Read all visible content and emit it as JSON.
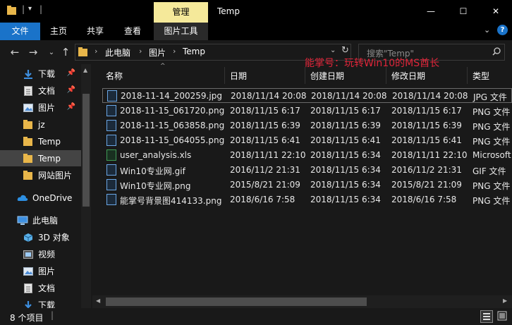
{
  "window": {
    "title": "Temp",
    "context_tab": "管理",
    "controls": {
      "minimize": "—",
      "maximize": "☐",
      "close": "✕"
    }
  },
  "ribbon": {
    "tabs": [
      "文件",
      "主页",
      "共享",
      "查看",
      "图片工具"
    ]
  },
  "address": {
    "crumbs": [
      "此电脑",
      "图片",
      "Temp"
    ],
    "search_placeholder": "搜索\"Temp\""
  },
  "watermark": "能掌号：玩转Win10的MS酋长",
  "nav": {
    "quick_access": [
      {
        "label": "下载",
        "pinned": true,
        "icon": "download-icon"
      },
      {
        "label": "文档",
        "pinned": true,
        "icon": "document-icon"
      },
      {
        "label": "图片",
        "pinned": true,
        "icon": "pictures-icon"
      },
      {
        "label": "jz",
        "pinned": false,
        "icon": "folder-icon"
      },
      {
        "label": "Temp",
        "pinned": false,
        "icon": "folder-icon"
      },
      {
        "label": "Temp",
        "pinned": false,
        "icon": "folder-icon",
        "selected": true
      },
      {
        "label": "网站图片",
        "pinned": false,
        "icon": "folder-icon"
      }
    ],
    "onedrive": "OneDrive",
    "this_pc": "此电脑",
    "pc_items": [
      {
        "label": "3D 对象",
        "icon": "3d-objects-icon"
      },
      {
        "label": "视频",
        "icon": "video-icon"
      },
      {
        "label": "图片",
        "icon": "pictures-icon"
      },
      {
        "label": "文档",
        "icon": "document-icon"
      },
      {
        "label": "下载",
        "icon": "download-icon"
      }
    ]
  },
  "columns": [
    "名称",
    "日期",
    "创建日期",
    "修改日期",
    "类型"
  ],
  "files": [
    {
      "name": "2018-11-14_200259.jpg",
      "date": "2018/11/14 20:08",
      "created": "2018/11/14 20:08",
      "modified": "2018/11/14 20:08",
      "type": "JPG 文件",
      "icon": "image-file-icon",
      "selected": true
    },
    {
      "name": "2018-11-15_061720.png",
      "date": "2018/11/15 6:17",
      "created": "2018/11/15 6:17",
      "modified": "2018/11/15 6:17",
      "type": "PNG 文件",
      "icon": "image-file-icon"
    },
    {
      "name": "2018-11-15_063858.png",
      "date": "2018/11/15 6:39",
      "created": "2018/11/15 6:39",
      "modified": "2018/11/15 6:39",
      "type": "PNG 文件",
      "icon": "image-file-icon"
    },
    {
      "name": "2018-11-15_064055.png",
      "date": "2018/11/15 6:41",
      "created": "2018/11/15 6:41",
      "modified": "2018/11/15 6:41",
      "type": "PNG 文件",
      "icon": "image-file-icon"
    },
    {
      "name": "user_analysis.xls",
      "date": "2018/11/11 22:10",
      "created": "2018/11/15 6:34",
      "modified": "2018/11/11 22:10",
      "type": "Microsoft",
      "icon": "excel-file-icon"
    },
    {
      "name": "Win10专业网.gif",
      "date": "2016/11/2 21:31",
      "created": "2018/11/15 6:34",
      "modified": "2016/11/2 21:31",
      "type": "GIF 文件",
      "icon": "image-file-icon"
    },
    {
      "name": "Win10专业网.png",
      "date": "2015/8/21 21:09",
      "created": "2018/11/15 6:34",
      "modified": "2015/8/21 21:09",
      "type": "PNG 文件",
      "icon": "image-file-icon"
    },
    {
      "name": "能掌号背景图414133.png",
      "date": "2018/6/16 7:58",
      "created": "2018/11/15 6:34",
      "modified": "2018/6/16 7:58",
      "type": "PNG 文件",
      "icon": "image-file-icon"
    }
  ],
  "status": {
    "count": "8 个项目"
  },
  "colors": {
    "accent": "#1a73c9",
    "context_tab": "#f5e99a",
    "watermark": "#e0263a",
    "background": "#191919"
  }
}
